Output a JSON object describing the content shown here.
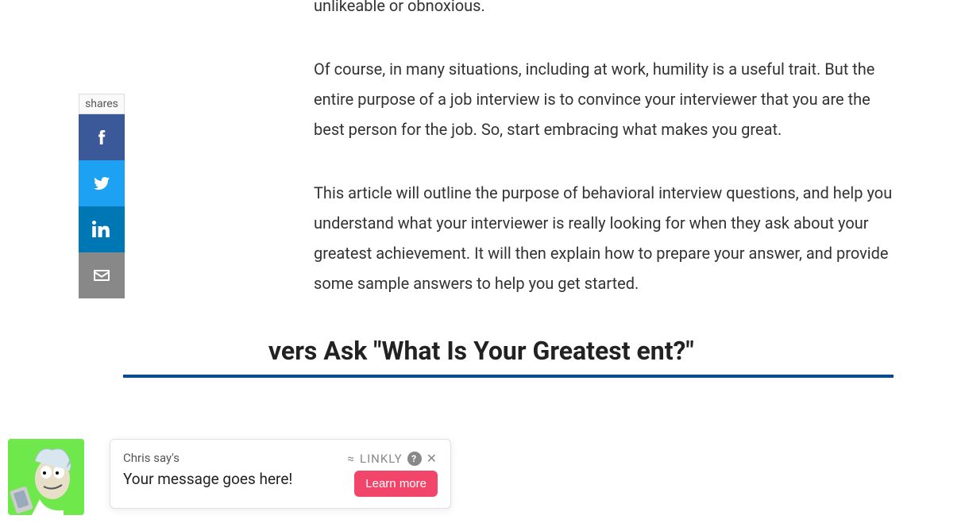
{
  "share": {
    "label": "shares"
  },
  "article": {
    "p1_line": "unlikeable or obnoxious.",
    "p2": "Of course, in many situations, including at work, humility is a useful trait. But the entire purpose of a job interview is to convince your interviewer that you are the best person for the job. So, start embracing what makes you great.",
    "p3": "This article will outline the purpose of behavioral interview questions, and help you understand what your interviewer is really looking for when they ask about your greatest achievement. It will then explain how to prepare your answer, and provide some sample answers to help you get started.",
    "heading_partial": "vers Ask \"What Is Your Greatest ent?\""
  },
  "chat": {
    "sender": "Chris say's",
    "message": "Your message goes here!",
    "brand": "LINKLY",
    "cta": "Learn more"
  }
}
